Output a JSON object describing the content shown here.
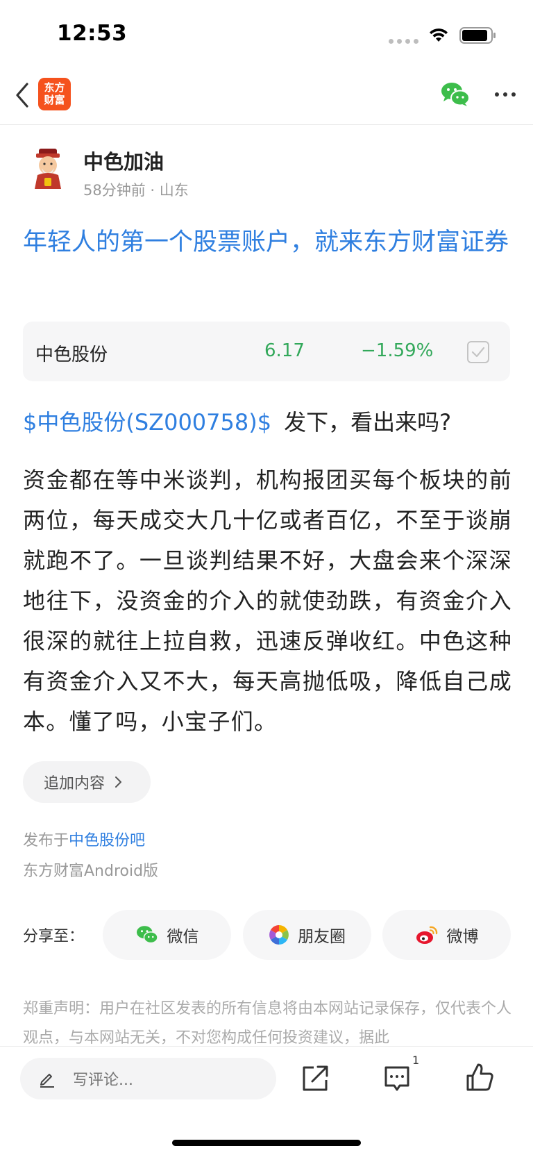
{
  "status_bar": {
    "time": "12:53"
  },
  "nav": {
    "app_logo_text_line1": "东方",
    "app_logo_text_line2": "财富"
  },
  "author": {
    "name": "中色加油",
    "meta": "58分钟前 · 山东"
  },
  "post": {
    "title": "年轻人的第一个股票账户，就来东方财富证券",
    "stock_card": {
      "name": "中色股份",
      "price": "6.17",
      "change": "−1.59%"
    },
    "stock_link": "$中色股份(SZ000758)$",
    "first_line_rest": "发下，看出来吗?",
    "body": "资金都在等中米谈判，机构报团买每个板块的前两位，每天成交大几十亿或者百亿，不至于谈崩就跑不了。一旦谈判结果不好，大盘会来个深深地往下，没资金的介入的就使劲跌，有资金介入很深的就往上拉自救，迅速反弹收红。中色这种有资金介入又不大，每天高抛低吸，降低自己成本。懂了吗，小宝子们。",
    "append_label": "追加内容",
    "published_prefix": "发布于",
    "published_bar": "中色股份吧",
    "client": "东方财富Android版"
  },
  "share": {
    "label": "分享至：",
    "wechat": "微信",
    "moments": "朋友圈",
    "weibo": "微博"
  },
  "disclaimer": "郑重声明：用户在社区发表的所有信息将由本网站记录保存，仅代表个人观点，与本网站无关，不对您构成任何投资建议，据此",
  "bottom_bar": {
    "comment_placeholder": "写评论...",
    "comment_count": "1"
  },
  "colors": {
    "link_blue": "#2f7fe0",
    "stock_green": "#32a85a",
    "logo_orange": "#f5521d",
    "wechat_green": "#3dbd4b"
  }
}
